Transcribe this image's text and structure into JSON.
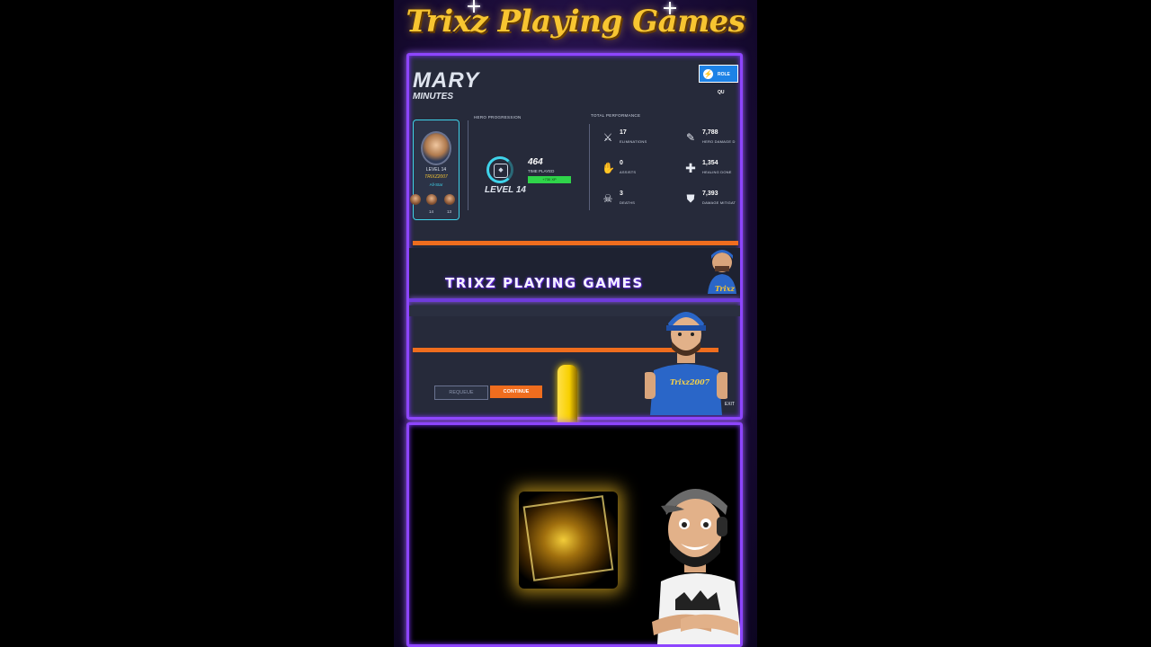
{
  "banner": {
    "title": "Trixz Playing Games"
  },
  "game": {
    "summary_title": "MARY",
    "duration": "MINUTES",
    "role_button": "ROLE QU",
    "hero": {
      "level": "LEVEL 14",
      "name": "TRIXZ2007",
      "tier": "All-Star",
      "mini_numbers": [
        "14",
        "13"
      ]
    },
    "hero_progression": {
      "label": "HERO PROGRESSION",
      "level": "LEVEL 14",
      "time_played_value": "464",
      "time_played_label": "TIME PLAYED",
      "bar_text": "+730 XP",
      "bar_fill_percent": 100
    },
    "total_performance": {
      "label": "TOTAL PERFORMANCE",
      "stats": [
        {
          "icon": "crossed-swords-icon",
          "value": "17",
          "label": "ELIMINATIONS"
        },
        {
          "icon": "hand-icon",
          "value": "0",
          "label": "ASSISTS"
        },
        {
          "icon": "skull-icon",
          "value": "3",
          "label": "DEATHS"
        },
        {
          "icon": "claw-icon",
          "value": "7,788",
          "label": "HERO DAMAGE D"
        },
        {
          "icon": "health-cross-icon",
          "value": "1,354",
          "label": "HEALING DONE"
        },
        {
          "icon": "shield-icon",
          "value": "7,393",
          "label": "DAMAGE MITIGAT"
        }
      ]
    },
    "stream_overlay_title": "TRIXZ PLAYING GAMES",
    "buttons": {
      "requeue": "REQUEUE",
      "continue": "CONTINUE",
      "exit": "EXIT"
    },
    "avatar_shirt_text": "Trixz2007",
    "corner_badge": "Trixz"
  },
  "colors": {
    "accent_purple": "#8e45ff",
    "banner_gold": "#f7c531",
    "hud_orange": "#ef6d1e",
    "hud_cyan": "#3fd3ea",
    "xp_green": "#2fd44a"
  }
}
